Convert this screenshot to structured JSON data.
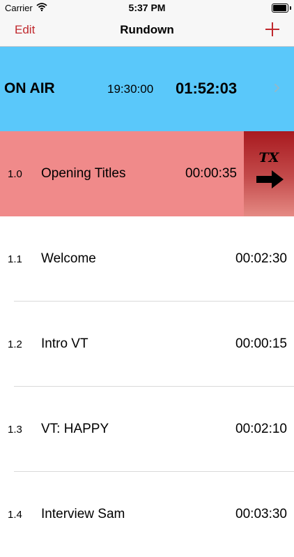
{
  "status_bar": {
    "carrier": "Carrier",
    "time": "5:37 PM",
    "battery_level": 0.95
  },
  "nav": {
    "edit_label": "Edit",
    "title": "Rundown",
    "add_icon": "plus-icon",
    "accent_color": "#c0282d"
  },
  "on_air": {
    "label": "ON AIR",
    "clock": "19:30:00",
    "remaining": "01:52:03",
    "background": "#5ac8fa"
  },
  "rundown": {
    "current_color": "#f08a8a",
    "items": [
      {
        "number": "1.0",
        "title": "Opening Titles",
        "duration": "00:00:35",
        "current": true
      },
      {
        "number": "1.1",
        "title": "Welcome",
        "duration": "00:02:30"
      },
      {
        "number": "1.2",
        "title": "Intro VT",
        "duration": "00:00:15"
      },
      {
        "number": "1.3",
        "title": "VT: HAPPY",
        "duration": "00:02:10"
      },
      {
        "number": "1.4",
        "title": "Interview Sam",
        "duration": "00:03:30"
      }
    ]
  },
  "tx_button": {
    "label": "TX",
    "icon": "arrow-right-icon"
  }
}
